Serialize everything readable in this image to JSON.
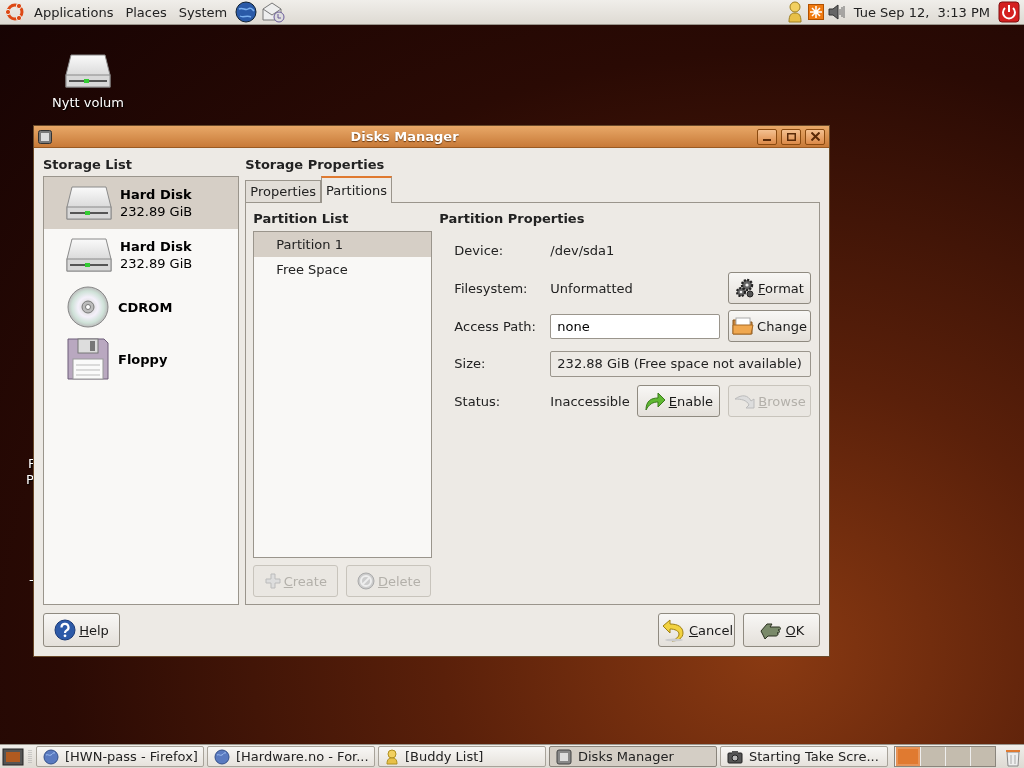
{
  "top_panel": {
    "menus": [
      {
        "label": "Applications"
      },
      {
        "label": "Places"
      },
      {
        "label": "System"
      }
    ],
    "clock": "Tue Sep 12,  3:13 PM"
  },
  "desktop": {
    "icons": [
      {
        "label": "Nytt volum"
      }
    ],
    "fragments": [
      "F",
      "P",
      "-"
    ]
  },
  "window": {
    "title": "Disks Manager",
    "storage_list": {
      "heading": "Storage List",
      "items": [
        {
          "kind": "harddisk",
          "name": "Hard Disk",
          "size": "232.89 GiB",
          "selected": true
        },
        {
          "kind": "harddisk",
          "name": "Hard Disk",
          "size": "232.89 GiB",
          "selected": false
        },
        {
          "kind": "cdrom",
          "name": "CDROM",
          "selected": false
        },
        {
          "kind": "floppy",
          "name": "Floppy",
          "selected": false
        }
      ]
    },
    "storage_properties": {
      "heading": "Storage Properties",
      "tabs": [
        {
          "label": "Properties",
          "selected": false
        },
        {
          "label": "Partitions",
          "selected": true
        }
      ],
      "partition_list": {
        "heading": "Partition List",
        "items": [
          {
            "label": "Partition 1",
            "selected": true
          },
          {
            "label": "Free Space",
            "selected": false
          }
        ],
        "buttons": [
          {
            "label": "Create",
            "disabled": true,
            "mnemonic": true
          },
          {
            "label": "Delete",
            "disabled": true,
            "mnemonic": true
          }
        ]
      },
      "partition_properties": {
        "heading": "Partition Properties",
        "rows": [
          {
            "kind": "value",
            "label": "Device:",
            "value": "/dev/sda1"
          },
          {
            "kind": "value",
            "label": "Filesystem:",
            "value": "Unformatted",
            "buttons": [
              {
                "label": "Format",
                "disabled": false,
                "mnemonic": true
              }
            ]
          },
          {
            "kind": "input",
            "label": "Access Path:",
            "value": "none",
            "buttons": [
              {
                "label": "Change",
                "disabled": false,
                "mnemonic": false
              }
            ]
          },
          {
            "kind": "readonly",
            "label": "Size:",
            "value": "232.88 GiB (Free space not available)"
          },
          {
            "kind": "value",
            "label": "Status:",
            "value": "Inaccessible",
            "buttons": [
              {
                "label": "Enable",
                "disabled": false,
                "mnemonic": true
              },
              {
                "label": "Browse",
                "disabled": true,
                "mnemonic": true
              }
            ]
          }
        ]
      }
    },
    "buttons": [
      {
        "label": "Help",
        "disabled": false,
        "mnemonic": true
      },
      {
        "label": "Cancel",
        "disabled": false,
        "mnemonic": true
      },
      {
        "label": "OK",
        "disabled": false,
        "mnemonic": true
      }
    ]
  },
  "taskbar": {
    "tasks": [
      {
        "label": "[HWN-pass - Firefox]",
        "selected": false
      },
      {
        "label": "[Hardware.no - For...",
        "selected": false
      },
      {
        "label": "[Buddy List]",
        "selected": false
      },
      {
        "label": "Disks Manager",
        "selected": true
      },
      {
        "label": "Starting Take Scre...",
        "selected": false
      }
    ],
    "workspaces": [
      {
        "selected": true
      },
      {
        "selected": false
      },
      {
        "selected": false
      },
      {
        "selected": false
      }
    ]
  }
}
